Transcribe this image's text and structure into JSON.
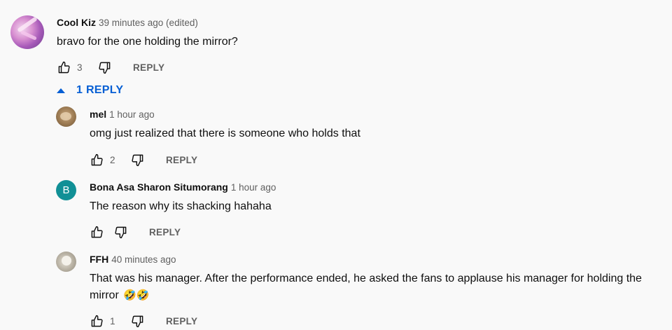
{
  "top_comment": {
    "author": "Cool Kiz",
    "time": "39 minutes ago (edited)",
    "text": "bravo for the one holding the mirror?",
    "likes": "3",
    "reply_label": "REPLY"
  },
  "replies_toggle": {
    "label": "1 REPLY"
  },
  "replies": [
    {
      "author": "mel",
      "time": "1 hour ago",
      "text": "omg just realized that there is someone who holds that",
      "likes": "2",
      "reply_label": "REPLY"
    },
    {
      "author": "Bona Asa Sharon Situmorang",
      "avatar_letter": "B",
      "time": "1 hour ago",
      "text": "The reason why its shacking hahaha",
      "likes": "",
      "reply_label": "REPLY"
    },
    {
      "author": "FFH",
      "time": "40 minutes ago",
      "text": "That was his manager. After the performance ended, he asked the fans to applause his manager for holding the mirror",
      "emoji": "🤣🤣",
      "likes": "1",
      "reply_label": "REPLY"
    }
  ],
  "icons": {
    "like": "thumbs-up-icon",
    "dislike": "thumbs-down-icon",
    "collapse": "caret-up-icon"
  },
  "colors": {
    "link_blue": "#065fd4",
    "secondary_text": "#606060",
    "avatar_b": "#119096"
  }
}
